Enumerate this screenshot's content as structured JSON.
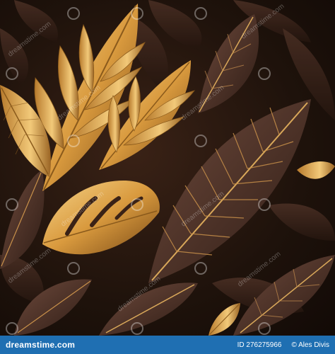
{
  "image": {
    "subject": "tropical-leaves",
    "colors": {
      "background": "#1e120b",
      "gold_light": "#f0c36a",
      "gold_dark": "#8a5a1c",
      "bronze": "#5a3a2a",
      "vein": "#d9a85a"
    }
  },
  "watermark": {
    "text": "dreamstime.com"
  },
  "footer": {
    "brand": "dreamstime.com",
    "id_label": "ID 276275966",
    "author": "Ales Divis",
    "copyright_symbol": "©",
    "background": "#1f6fb2"
  }
}
